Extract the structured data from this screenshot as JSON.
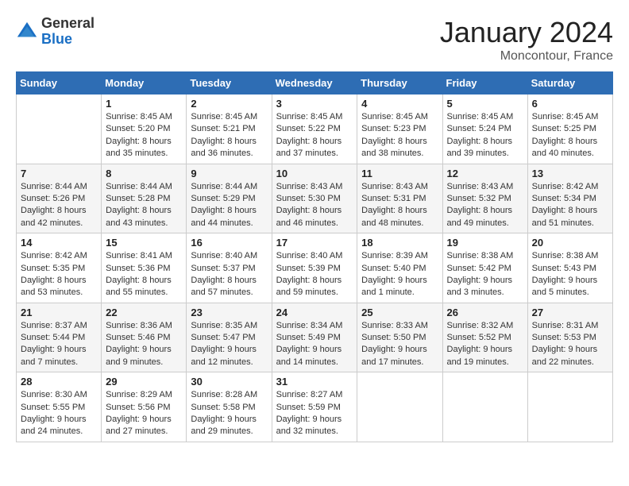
{
  "logo": {
    "general": "General",
    "blue": "Blue"
  },
  "header": {
    "month": "January 2024",
    "location": "Moncontour, France"
  },
  "weekdays": [
    "Sunday",
    "Monday",
    "Tuesday",
    "Wednesday",
    "Thursday",
    "Friday",
    "Saturday"
  ],
  "weeks": [
    [
      {
        "day": "",
        "info": ""
      },
      {
        "day": "1",
        "info": "Sunrise: 8:45 AM\nSunset: 5:20 PM\nDaylight: 8 hours\nand 35 minutes."
      },
      {
        "day": "2",
        "info": "Sunrise: 8:45 AM\nSunset: 5:21 PM\nDaylight: 8 hours\nand 36 minutes."
      },
      {
        "day": "3",
        "info": "Sunrise: 8:45 AM\nSunset: 5:22 PM\nDaylight: 8 hours\nand 37 minutes."
      },
      {
        "day": "4",
        "info": "Sunrise: 8:45 AM\nSunset: 5:23 PM\nDaylight: 8 hours\nand 38 minutes."
      },
      {
        "day": "5",
        "info": "Sunrise: 8:45 AM\nSunset: 5:24 PM\nDaylight: 8 hours\nand 39 minutes."
      },
      {
        "day": "6",
        "info": "Sunrise: 8:45 AM\nSunset: 5:25 PM\nDaylight: 8 hours\nand 40 minutes."
      }
    ],
    [
      {
        "day": "7",
        "info": "Sunrise: 8:44 AM\nSunset: 5:26 PM\nDaylight: 8 hours\nand 42 minutes."
      },
      {
        "day": "8",
        "info": "Sunrise: 8:44 AM\nSunset: 5:28 PM\nDaylight: 8 hours\nand 43 minutes."
      },
      {
        "day": "9",
        "info": "Sunrise: 8:44 AM\nSunset: 5:29 PM\nDaylight: 8 hours\nand 44 minutes."
      },
      {
        "day": "10",
        "info": "Sunrise: 8:43 AM\nSunset: 5:30 PM\nDaylight: 8 hours\nand 46 minutes."
      },
      {
        "day": "11",
        "info": "Sunrise: 8:43 AM\nSunset: 5:31 PM\nDaylight: 8 hours\nand 48 minutes."
      },
      {
        "day": "12",
        "info": "Sunrise: 8:43 AM\nSunset: 5:32 PM\nDaylight: 8 hours\nand 49 minutes."
      },
      {
        "day": "13",
        "info": "Sunrise: 8:42 AM\nSunset: 5:34 PM\nDaylight: 8 hours\nand 51 minutes."
      }
    ],
    [
      {
        "day": "14",
        "info": "Sunrise: 8:42 AM\nSunset: 5:35 PM\nDaylight: 8 hours\nand 53 minutes."
      },
      {
        "day": "15",
        "info": "Sunrise: 8:41 AM\nSunset: 5:36 PM\nDaylight: 8 hours\nand 55 minutes."
      },
      {
        "day": "16",
        "info": "Sunrise: 8:40 AM\nSunset: 5:37 PM\nDaylight: 8 hours\nand 57 minutes."
      },
      {
        "day": "17",
        "info": "Sunrise: 8:40 AM\nSunset: 5:39 PM\nDaylight: 8 hours\nand 59 minutes."
      },
      {
        "day": "18",
        "info": "Sunrise: 8:39 AM\nSunset: 5:40 PM\nDaylight: 9 hours\nand 1 minute."
      },
      {
        "day": "19",
        "info": "Sunrise: 8:38 AM\nSunset: 5:42 PM\nDaylight: 9 hours\nand 3 minutes."
      },
      {
        "day": "20",
        "info": "Sunrise: 8:38 AM\nSunset: 5:43 PM\nDaylight: 9 hours\nand 5 minutes."
      }
    ],
    [
      {
        "day": "21",
        "info": "Sunrise: 8:37 AM\nSunset: 5:44 PM\nDaylight: 9 hours\nand 7 minutes."
      },
      {
        "day": "22",
        "info": "Sunrise: 8:36 AM\nSunset: 5:46 PM\nDaylight: 9 hours\nand 9 minutes."
      },
      {
        "day": "23",
        "info": "Sunrise: 8:35 AM\nSunset: 5:47 PM\nDaylight: 9 hours\nand 12 minutes."
      },
      {
        "day": "24",
        "info": "Sunrise: 8:34 AM\nSunset: 5:49 PM\nDaylight: 9 hours\nand 14 minutes."
      },
      {
        "day": "25",
        "info": "Sunrise: 8:33 AM\nSunset: 5:50 PM\nDaylight: 9 hours\nand 17 minutes."
      },
      {
        "day": "26",
        "info": "Sunrise: 8:32 AM\nSunset: 5:52 PM\nDaylight: 9 hours\nand 19 minutes."
      },
      {
        "day": "27",
        "info": "Sunrise: 8:31 AM\nSunset: 5:53 PM\nDaylight: 9 hours\nand 22 minutes."
      }
    ],
    [
      {
        "day": "28",
        "info": "Sunrise: 8:30 AM\nSunset: 5:55 PM\nDaylight: 9 hours\nand 24 minutes."
      },
      {
        "day": "29",
        "info": "Sunrise: 8:29 AM\nSunset: 5:56 PM\nDaylight: 9 hours\nand 27 minutes."
      },
      {
        "day": "30",
        "info": "Sunrise: 8:28 AM\nSunset: 5:58 PM\nDaylight: 9 hours\nand 29 minutes."
      },
      {
        "day": "31",
        "info": "Sunrise: 8:27 AM\nSunset: 5:59 PM\nDaylight: 9 hours\nand 32 minutes."
      },
      {
        "day": "",
        "info": ""
      },
      {
        "day": "",
        "info": ""
      },
      {
        "day": "",
        "info": ""
      }
    ]
  ]
}
